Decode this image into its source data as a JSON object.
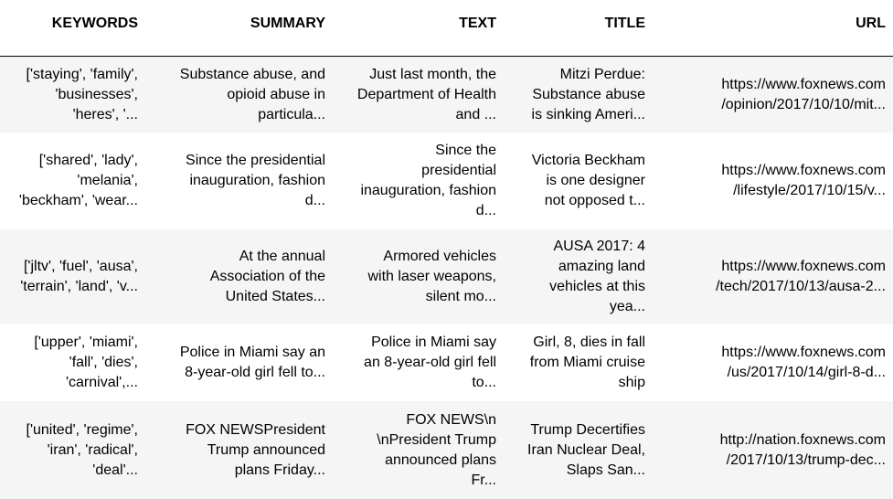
{
  "columns": [
    "KEYWORDS",
    "SUMMARY",
    "TEXT",
    "TITLE",
    "URL"
  ],
  "rows": [
    {
      "keywords": "['staying', 'family',\n'businesses',\n'heres', '...",
      "summary": "Substance abuse, and\nopioid abuse in\nparticula...",
      "text": "Just last month, the\nDepartment of Health\nand ...",
      "title": "Mitzi Perdue:\nSubstance abuse\nis sinking Ameri...",
      "url": "https://www.foxnews.com\n/opinion/2017/10/10/mit..."
    },
    {
      "keywords": "['shared', 'lady',\n'melania',\n'beckham', 'wear...",
      "summary": "Since the presidential\ninauguration, fashion\nd...",
      "text": "Since the\npresidential\ninauguration, fashion\nd...",
      "title": "Victoria Beckham\nis one designer\nnot opposed t...",
      "url": "https://www.foxnews.com\n/lifestyle/2017/10/15/v..."
    },
    {
      "keywords": "['jltv', 'fuel', 'ausa',\n'terrain', 'land', 'v...",
      "summary": "At the annual\nAssociation of the\nUnited States...",
      "text": "Armored vehicles\nwith laser weapons,\nsilent mo...",
      "title": "AUSA 2017: 4\namazing land\nvehicles at this\nyea...",
      "url": "https://www.foxnews.com\n/tech/2017/10/13/ausa-2..."
    },
    {
      "keywords": "['upper', 'miami',\n'fall', 'dies',\n'carnival',...",
      "summary": "Police in Miami say an\n8-year-old girl fell to...",
      "text": "Police in Miami say\nan 8-year-old girl fell\nto...",
      "title": "Girl, 8, dies in fall\nfrom Miami cruise\nship",
      "url": "https://www.foxnews.com\n/us/2017/10/14/girl-8-d..."
    },
    {
      "keywords": "['united', 'regime',\n'iran', 'radical',\n'deal'...",
      "summary": "FOX NEWSPresident\nTrump announced\nplans Friday...",
      "text": "FOX NEWS\\n\n\\nPresident Trump\nannounced plans\nFr...",
      "title": "Trump Decertifies\nIran Nuclear Deal,\nSlaps San...",
      "url": "http://nation.foxnews.com\n/2017/10/13/trump-dec..."
    }
  ]
}
